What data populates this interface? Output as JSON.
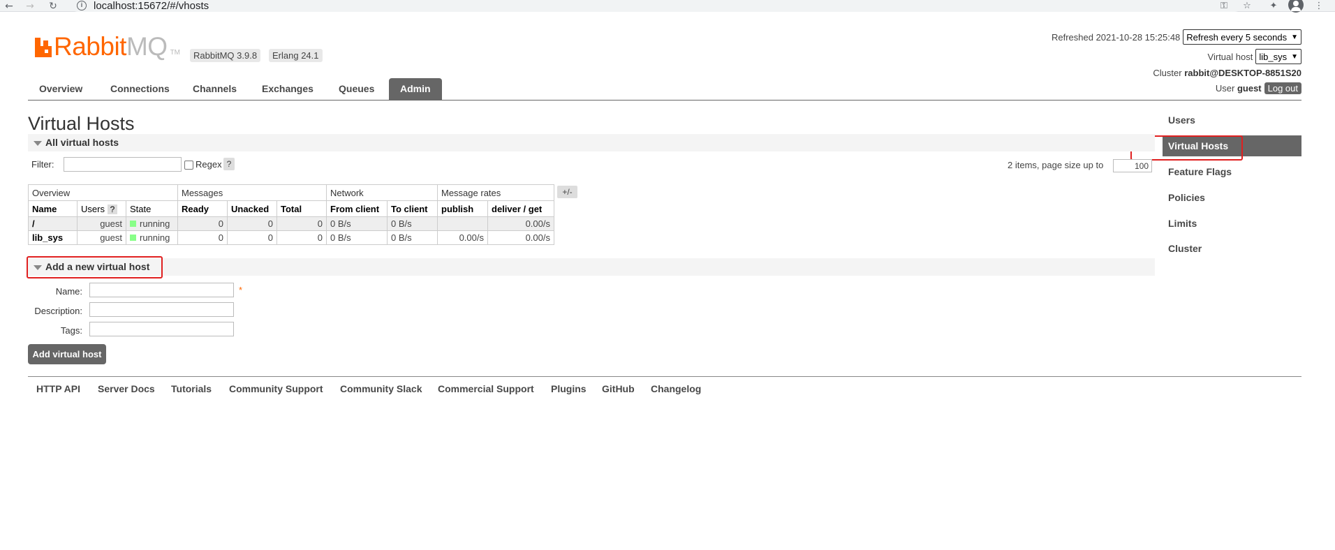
{
  "browser": {
    "url": "localhost:15672/#/vhosts",
    "info_icon": "i"
  },
  "header": {
    "logo_primary": "Rabbit",
    "logo_secondary": "MQ",
    "logo_tm": "TM",
    "rabbitmq_version": "RabbitMQ 3.9.8",
    "erlang_version": "Erlang 24.1",
    "refreshed_label": "Refreshed 2021-10-28 15:25:48",
    "refresh_select": "Refresh every 5 seconds",
    "virtual_host_label": "Virtual host",
    "virtual_host_select": "lib_sys",
    "cluster_label": "Cluster",
    "cluster_value": "rabbit@DESKTOP-8851S20",
    "user_label": "User",
    "user_value": "guest",
    "logout_label": "Log out"
  },
  "tabs": [
    {
      "label": "Overview"
    },
    {
      "label": "Connections"
    },
    {
      "label": "Channels"
    },
    {
      "label": "Exchanges"
    },
    {
      "label": "Queues"
    },
    {
      "label": "Admin",
      "active": true
    }
  ],
  "sidebar": {
    "items": [
      {
        "label": "Users"
      },
      {
        "label": "Virtual Hosts",
        "active": true
      },
      {
        "label": "Feature Flags"
      },
      {
        "label": "Policies"
      },
      {
        "label": "Limits"
      },
      {
        "label": "Cluster"
      }
    ]
  },
  "main": {
    "title": "Virtual Hosts",
    "all_section_title": "All virtual hosts",
    "filter_label": "Filter:",
    "filter_value": "",
    "regex_label": "Regex",
    "regex_help": "?",
    "pager_text": "2 items, page size up to",
    "page_size": "100",
    "plus_minus": "+/-"
  },
  "table": {
    "groups": [
      "Overview",
      "Messages",
      "Network",
      "Message rates"
    ],
    "columns": {
      "name": "Name",
      "users": "Users",
      "users_help": "?",
      "state": "State",
      "ready": "Ready",
      "unacked": "Unacked",
      "total": "Total",
      "from_client": "From client",
      "to_client": "To client",
      "publish": "publish",
      "deliver_get": "deliver / get"
    },
    "rows": [
      {
        "name": "/",
        "users": "guest",
        "state": "running",
        "ready": "0",
        "unacked": "0",
        "total": "0",
        "from_client": "0 B/s",
        "to_client": "0 B/s",
        "publish": "",
        "deliver_get": "0.00/s"
      },
      {
        "name": "lib_sys",
        "users": "guest",
        "state": "running",
        "ready": "0",
        "unacked": "0",
        "total": "0",
        "from_client": "0 B/s",
        "to_client": "0 B/s",
        "publish": "0.00/s",
        "deliver_get": "0.00/s"
      }
    ]
  },
  "add_form": {
    "section_title": "Add a new virtual host",
    "name_label": "Name:",
    "description_label": "Description:",
    "tags_label": "Tags:",
    "required_mark": "*",
    "name_value": "",
    "description_value": "",
    "tags_value": "",
    "submit_label": "Add virtual host"
  },
  "footer": {
    "links": [
      "HTTP API",
      "Server Docs",
      "Tutorials",
      "Community Support",
      "Community Slack",
      "Commercial Support",
      "Plugins",
      "GitHub",
      "Changelog"
    ]
  },
  "colors": {
    "brand_orange": "#ff6600",
    "nav_active_bg": "#666666",
    "highlight_red": "#e02020",
    "state_green": "#88ff88"
  }
}
